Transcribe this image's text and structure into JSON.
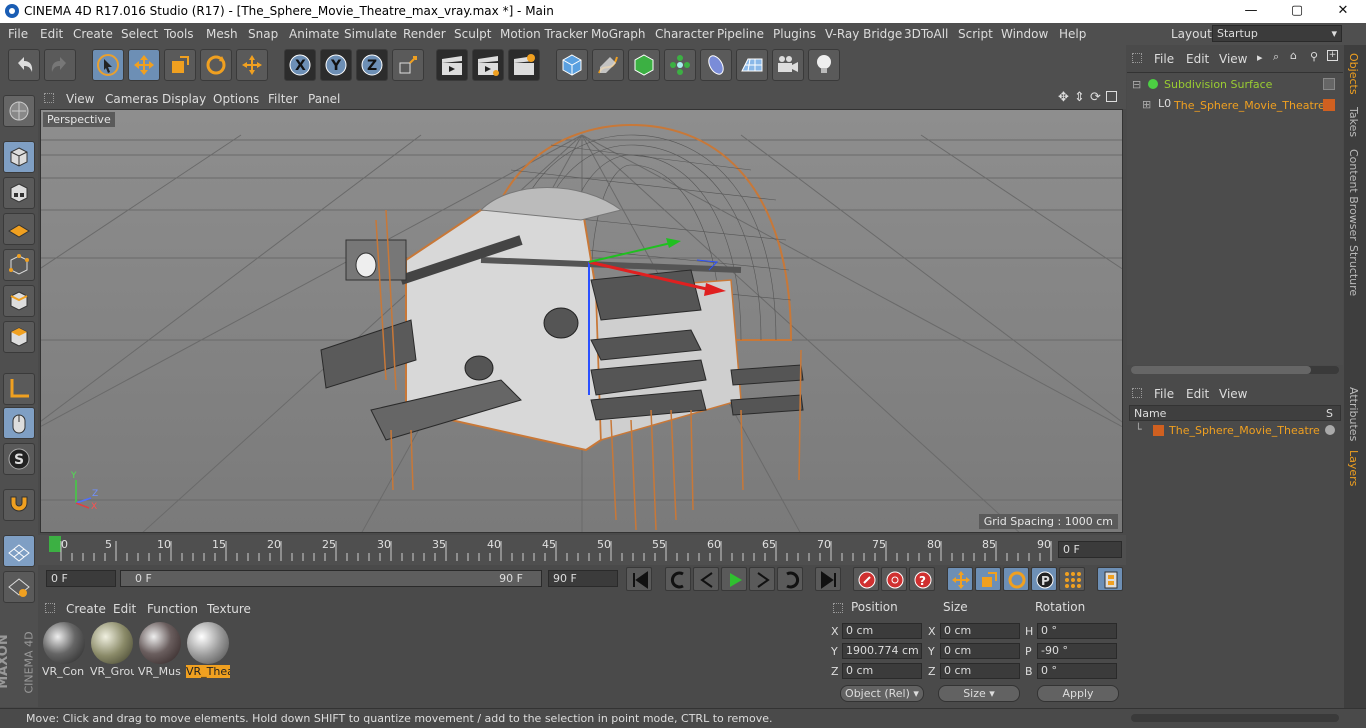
{
  "window": {
    "title": "CINEMA 4D R17.016 Studio (R17) - [The_Sphere_Movie_Theatre_max_vray.max *] - Main",
    "minimize": "—",
    "maximize": "▢",
    "close": "✕"
  },
  "menubar": {
    "items": [
      "File",
      "Edit",
      "Create",
      "Select",
      "Tools",
      "Mesh",
      "Snap",
      "Animate",
      "Simulate",
      "Render",
      "Sculpt",
      "Motion Tracker",
      "MoGraph",
      "Character",
      "Pipeline",
      "Plugins",
      "V-Ray Bridge",
      "3DToAll",
      "Script",
      "Window",
      "Help"
    ],
    "layout_label": "Layout:",
    "layout_value": "Startup"
  },
  "viewport": {
    "menu": [
      "View",
      "Cameras",
      "Display",
      "Options",
      "Filter",
      "Panel"
    ],
    "label": "Perspective",
    "grid_spacing": "Grid Spacing : 1000 cm",
    "axis": {
      "y": "Y",
      "z": "Z",
      "x": "X"
    }
  },
  "timeline": {
    "ticks": [
      "0",
      "5",
      "10",
      "15",
      "20",
      "25",
      "30",
      "35",
      "40",
      "45",
      "50",
      "55",
      "60",
      "65",
      "70",
      "75",
      "80",
      "85",
      "90"
    ],
    "current_frame": "0 F"
  },
  "playbar": {
    "start": "0 F",
    "range_start": "0 F",
    "range_end": "90 F",
    "end": "90 F"
  },
  "material_manager": {
    "menu": [
      "Create",
      "Edit",
      "Function",
      "Texture"
    ],
    "materials": [
      {
        "name": "VR_Con",
        "color": "#5a5a5a"
      },
      {
        "name": "VR_Grou",
        "color": "#8a8a68"
      },
      {
        "name": "VR_Mus",
        "color": "#6a5e5e"
      },
      {
        "name": "VR_Thea",
        "color": "#9a9a9a",
        "selected": true
      }
    ]
  },
  "coordinates": {
    "headers": {
      "position": "Position",
      "size": "Size",
      "rotation": "Rotation"
    },
    "rows": [
      {
        "axis": "X",
        "pos": "0 cm",
        "size_axis": "X",
        "size": "0 cm",
        "rot_axis": "H",
        "rot": "0 °"
      },
      {
        "axis": "Y",
        "pos": "1900.774 cm",
        "size_axis": "Y",
        "size": "0 cm",
        "rot_axis": "P",
        "rot": "-90 °"
      },
      {
        "axis": "Z",
        "pos": "0 cm",
        "size_axis": "Z",
        "size": "0 cm",
        "rot_axis": "B",
        "rot": "0 °"
      }
    ],
    "mode": "Object (Rel)",
    "size_mode": "Size",
    "apply": "Apply"
  },
  "objects_panel": {
    "menu": [
      "File",
      "Edit",
      "View"
    ],
    "items": [
      {
        "name": "Subdivision Surface",
        "color": "#9acd32"
      },
      {
        "name": "The_Sphere_Movie_Theatre",
        "color": "#f0a020"
      }
    ]
  },
  "layers_panel": {
    "menu": [
      "File",
      "Edit",
      "View"
    ],
    "col_name": "Name",
    "col_s": "S",
    "items": [
      {
        "name": "The_Sphere_Movie_Theatre"
      }
    ]
  },
  "right_tabs": [
    "Objects",
    "Takes",
    "Content Browser",
    "Structure",
    "Attributes",
    "Layers"
  ],
  "status": "Move: Click and drag to move elements. Hold down SHIFT to quantize movement / add to the selection in point mode, CTRL to remove.",
  "brand": {
    "name": "MAXON",
    "product": "CINEMA 4D"
  }
}
